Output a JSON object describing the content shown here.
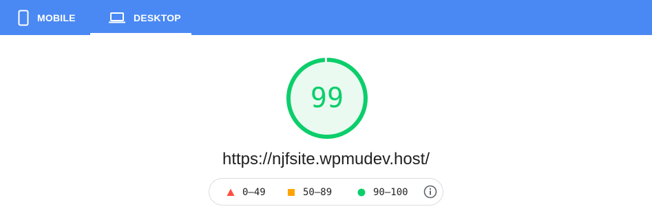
{
  "tabs": [
    {
      "label": "MOBILE",
      "icon": "mobile-phone-icon",
      "selected": false
    },
    {
      "label": "DESKTOP",
      "icon": "laptop-icon",
      "selected": true
    }
  ],
  "score": {
    "value": "99",
    "fraction": 0.99,
    "color": "#0cce6b",
    "fill": "#eafaf1"
  },
  "url": "https://njfsite.wpmudev.host/",
  "legend": {
    "fail": {
      "label": "0–49",
      "icon": "triangle-icon",
      "color": "#ff4e42"
    },
    "average": {
      "label": "50–89",
      "icon": "square-icon",
      "color": "#ffa400"
    },
    "pass": {
      "label": "90–100",
      "icon": "circle-icon",
      "color": "#0cce6b"
    },
    "info_icon": "info-icon"
  },
  "colors": {
    "tabbar": "#4a89f3"
  }
}
